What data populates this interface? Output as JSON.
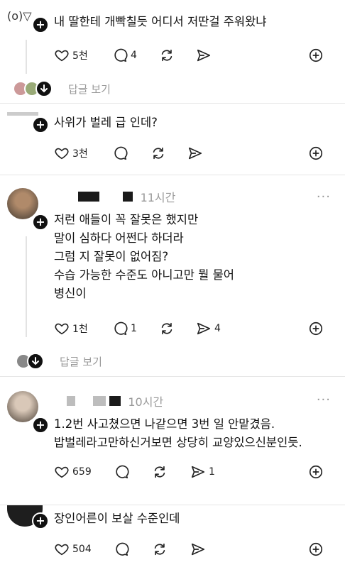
{
  "posts": [
    {
      "text": "내 딸한테 개빡칠듯 어디서 저딴걸 주워왔냐",
      "likes": "5천",
      "comments": "4",
      "reposts": "",
      "shares": "",
      "replies_label": "답글 보기"
    },
    {
      "text": "사위가 벌레 급 인데?",
      "likes": "3천",
      "comments": "",
      "reposts": "",
      "shares": ""
    },
    {
      "time": "11시간",
      "text": "저런 애들이 꼭 잘못은 했지만\n말이 심하다 어쩐다 하더라\n그럼 지 잘못이 없어짐?\n수습 가능한 수준도 아니고만 뭘 물어\n병신이",
      "likes": "1천",
      "comments": "1",
      "reposts": "",
      "shares": "4",
      "replies_label": "답글 보기"
    },
    {
      "time": "10시간",
      "text": "1.2번 사고쳤으면 나같으면 3번 일 안맡겼음.\n밥벌레라고만하신거보면 상당히 교양있으신분인듯.",
      "likes": "659",
      "comments": "",
      "reposts": "",
      "shares": "1"
    },
    {
      "text": "장인어른이 보살 수준인데",
      "likes": "504",
      "comments": "",
      "reposts": "",
      "shares": ""
    }
  ],
  "more_label": "···"
}
